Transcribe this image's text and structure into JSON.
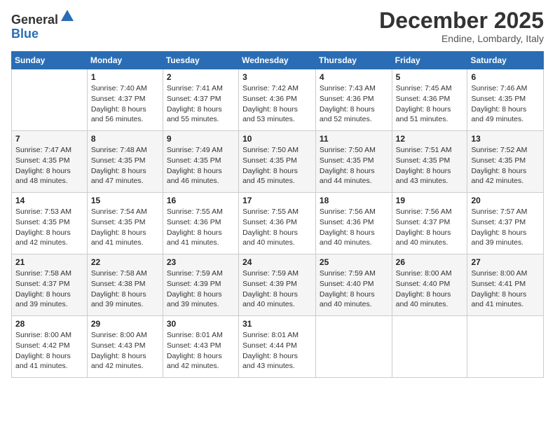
{
  "header": {
    "logo_general": "General",
    "logo_blue": "Blue",
    "month": "December 2025",
    "location": "Endine, Lombardy, Italy"
  },
  "weekdays": [
    "Sunday",
    "Monday",
    "Tuesday",
    "Wednesday",
    "Thursday",
    "Friday",
    "Saturday"
  ],
  "weeks": [
    [
      {
        "day": "",
        "info": ""
      },
      {
        "day": "1",
        "info": "Sunrise: 7:40 AM\nSunset: 4:37 PM\nDaylight: 8 hours\nand 56 minutes."
      },
      {
        "day": "2",
        "info": "Sunrise: 7:41 AM\nSunset: 4:37 PM\nDaylight: 8 hours\nand 55 minutes."
      },
      {
        "day": "3",
        "info": "Sunrise: 7:42 AM\nSunset: 4:36 PM\nDaylight: 8 hours\nand 53 minutes."
      },
      {
        "day": "4",
        "info": "Sunrise: 7:43 AM\nSunset: 4:36 PM\nDaylight: 8 hours\nand 52 minutes."
      },
      {
        "day": "5",
        "info": "Sunrise: 7:45 AM\nSunset: 4:36 PM\nDaylight: 8 hours\nand 51 minutes."
      },
      {
        "day": "6",
        "info": "Sunrise: 7:46 AM\nSunset: 4:35 PM\nDaylight: 8 hours\nand 49 minutes."
      }
    ],
    [
      {
        "day": "7",
        "info": "Sunrise: 7:47 AM\nSunset: 4:35 PM\nDaylight: 8 hours\nand 48 minutes."
      },
      {
        "day": "8",
        "info": "Sunrise: 7:48 AM\nSunset: 4:35 PM\nDaylight: 8 hours\nand 47 minutes."
      },
      {
        "day": "9",
        "info": "Sunrise: 7:49 AM\nSunset: 4:35 PM\nDaylight: 8 hours\nand 46 minutes."
      },
      {
        "day": "10",
        "info": "Sunrise: 7:50 AM\nSunset: 4:35 PM\nDaylight: 8 hours\nand 45 minutes."
      },
      {
        "day": "11",
        "info": "Sunrise: 7:50 AM\nSunset: 4:35 PM\nDaylight: 8 hours\nand 44 minutes."
      },
      {
        "day": "12",
        "info": "Sunrise: 7:51 AM\nSunset: 4:35 PM\nDaylight: 8 hours\nand 43 minutes."
      },
      {
        "day": "13",
        "info": "Sunrise: 7:52 AM\nSunset: 4:35 PM\nDaylight: 8 hours\nand 42 minutes."
      }
    ],
    [
      {
        "day": "14",
        "info": "Sunrise: 7:53 AM\nSunset: 4:35 PM\nDaylight: 8 hours\nand 42 minutes."
      },
      {
        "day": "15",
        "info": "Sunrise: 7:54 AM\nSunset: 4:35 PM\nDaylight: 8 hours\nand 41 minutes."
      },
      {
        "day": "16",
        "info": "Sunrise: 7:55 AM\nSunset: 4:36 PM\nDaylight: 8 hours\nand 41 minutes."
      },
      {
        "day": "17",
        "info": "Sunrise: 7:55 AM\nSunset: 4:36 PM\nDaylight: 8 hours\nand 40 minutes."
      },
      {
        "day": "18",
        "info": "Sunrise: 7:56 AM\nSunset: 4:36 PM\nDaylight: 8 hours\nand 40 minutes."
      },
      {
        "day": "19",
        "info": "Sunrise: 7:56 AM\nSunset: 4:37 PM\nDaylight: 8 hours\nand 40 minutes."
      },
      {
        "day": "20",
        "info": "Sunrise: 7:57 AM\nSunset: 4:37 PM\nDaylight: 8 hours\nand 39 minutes."
      }
    ],
    [
      {
        "day": "21",
        "info": "Sunrise: 7:58 AM\nSunset: 4:37 PM\nDaylight: 8 hours\nand 39 minutes."
      },
      {
        "day": "22",
        "info": "Sunrise: 7:58 AM\nSunset: 4:38 PM\nDaylight: 8 hours\nand 39 minutes."
      },
      {
        "day": "23",
        "info": "Sunrise: 7:59 AM\nSunset: 4:39 PM\nDaylight: 8 hours\nand 39 minutes."
      },
      {
        "day": "24",
        "info": "Sunrise: 7:59 AM\nSunset: 4:39 PM\nDaylight: 8 hours\nand 40 minutes."
      },
      {
        "day": "25",
        "info": "Sunrise: 7:59 AM\nSunset: 4:40 PM\nDaylight: 8 hours\nand 40 minutes."
      },
      {
        "day": "26",
        "info": "Sunrise: 8:00 AM\nSunset: 4:40 PM\nDaylight: 8 hours\nand 40 minutes."
      },
      {
        "day": "27",
        "info": "Sunrise: 8:00 AM\nSunset: 4:41 PM\nDaylight: 8 hours\nand 41 minutes."
      }
    ],
    [
      {
        "day": "28",
        "info": "Sunrise: 8:00 AM\nSunset: 4:42 PM\nDaylight: 8 hours\nand 41 minutes."
      },
      {
        "day": "29",
        "info": "Sunrise: 8:00 AM\nSunset: 4:43 PM\nDaylight: 8 hours\nand 42 minutes."
      },
      {
        "day": "30",
        "info": "Sunrise: 8:01 AM\nSunset: 4:43 PM\nDaylight: 8 hours\nand 42 minutes."
      },
      {
        "day": "31",
        "info": "Sunrise: 8:01 AM\nSunset: 4:44 PM\nDaylight: 8 hours\nand 43 minutes."
      },
      {
        "day": "",
        "info": ""
      },
      {
        "day": "",
        "info": ""
      },
      {
        "day": "",
        "info": ""
      }
    ]
  ]
}
